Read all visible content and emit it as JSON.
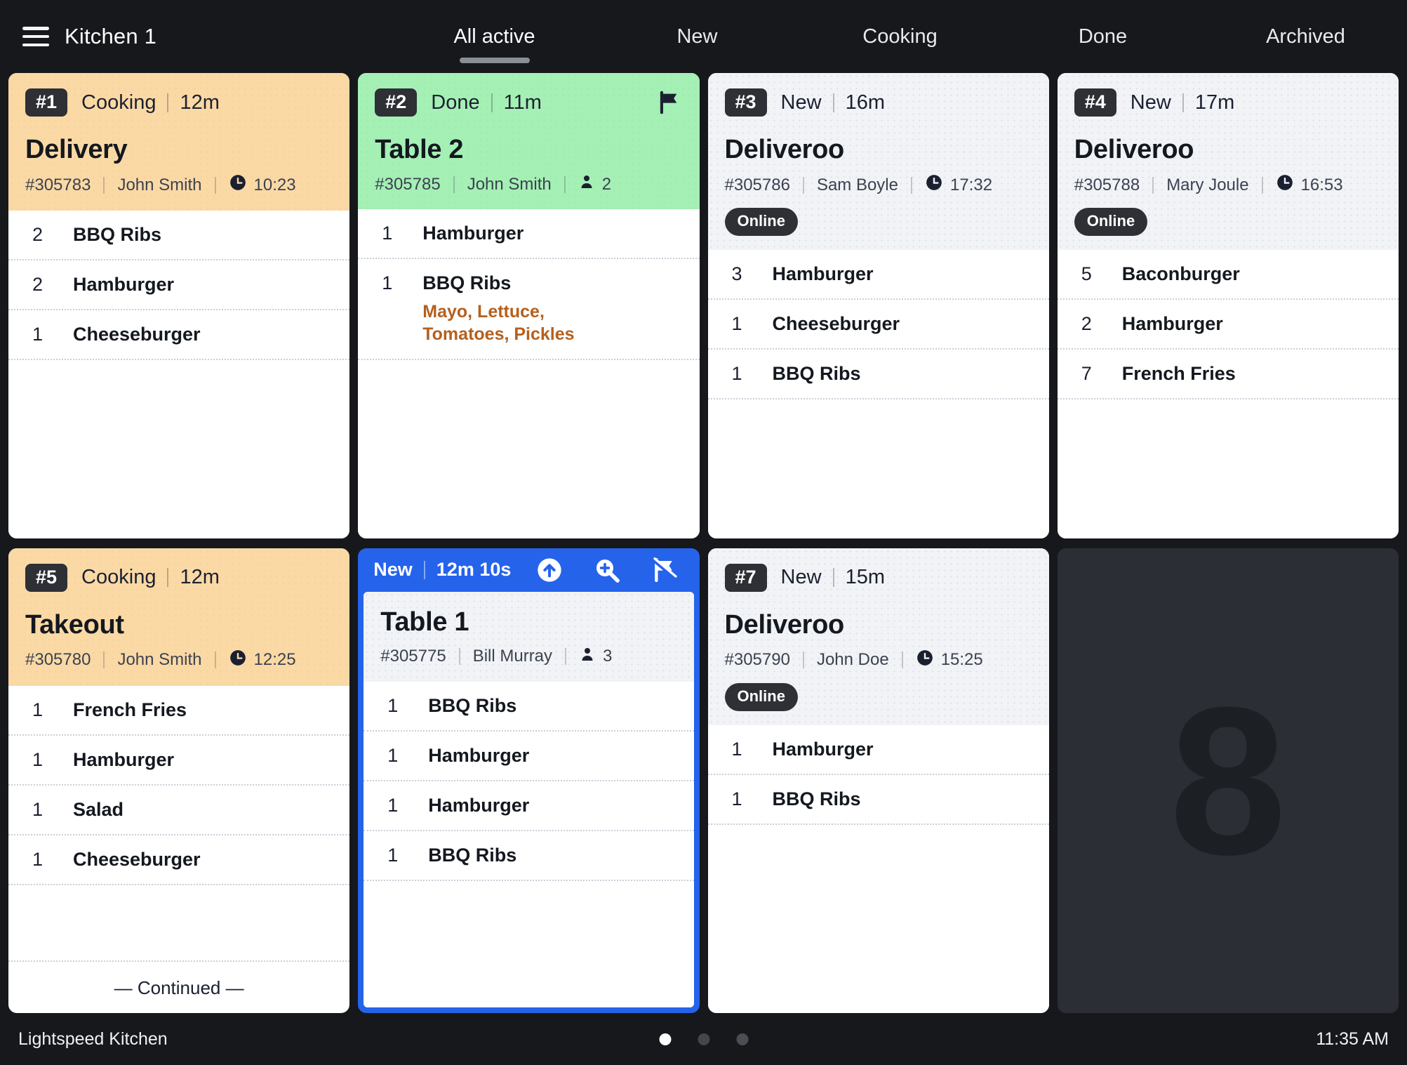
{
  "header": {
    "menu_icon": "hamburger-icon",
    "title": "Kitchen 1",
    "tabs": [
      {
        "label": "All active",
        "active": true
      },
      {
        "label": "New",
        "active": false
      },
      {
        "label": "Cooking",
        "active": false
      },
      {
        "label": "Done",
        "active": false
      },
      {
        "label": "Archived",
        "active": false
      }
    ]
  },
  "colors": {
    "app_background": "#16181c",
    "cooking": "#fbd9a5",
    "done": "#a5f0b5",
    "neutral": "#f1f3f6",
    "selected": "#2563eb",
    "modifier_text": "#b5601d",
    "badge": "#2e3035"
  },
  "cards": [
    {
      "position": "#1",
      "status": "Cooking",
      "elapsed": "12m",
      "title": "Delivery",
      "order_id": "#305783",
      "server": "John Smith",
      "meta_icon": "clock-icon",
      "meta_value": "10:23",
      "badge": null,
      "flagged": false,
      "theme": "cooking",
      "items": [
        {
          "qty": "2",
          "name": "BBQ Ribs",
          "mods": null
        },
        {
          "qty": "2",
          "name": "Hamburger",
          "mods": null
        },
        {
          "qty": "1",
          "name": "Cheeseburger",
          "mods": null
        }
      ],
      "continued": false
    },
    {
      "position": "#2",
      "status": "Done",
      "elapsed": "11m",
      "title": "Table 2",
      "order_id": "#305785",
      "server": "John Smith",
      "meta_icon": "guest-icon",
      "meta_value": "2",
      "badge": null,
      "flagged": true,
      "theme": "done",
      "items": [
        {
          "qty": "1",
          "name": "Hamburger",
          "mods": null
        },
        {
          "qty": "1",
          "name": "BBQ Ribs",
          "mods": "Mayo, Lettuce, Tomatoes, Pickles"
        }
      ],
      "continued": false
    },
    {
      "position": "#3",
      "status": "New",
      "elapsed": "16m",
      "title": "Deliveroo",
      "order_id": "#305786",
      "server": "Sam Boyle",
      "meta_icon": "clock-icon",
      "meta_value": "17:32",
      "badge": "Online",
      "flagged": false,
      "theme": "neutral",
      "items": [
        {
          "qty": "3",
          "name": "Hamburger",
          "mods": null
        },
        {
          "qty": "1",
          "name": "Cheeseburger",
          "mods": null
        },
        {
          "qty": "1",
          "name": "BBQ Ribs",
          "mods": null
        }
      ],
      "continued": false
    },
    {
      "position": "#4",
      "status": "New",
      "elapsed": "17m",
      "title": "Deliveroo",
      "order_id": "#305788",
      "server": "Mary Joule",
      "meta_icon": "clock-icon",
      "meta_value": "16:53",
      "badge": "Online",
      "flagged": false,
      "theme": "neutral",
      "items": [
        {
          "qty": "5",
          "name": "Baconburger",
          "mods": null
        },
        {
          "qty": "2",
          "name": "Hamburger",
          "mods": null
        },
        {
          "qty": "7",
          "name": "French Fries",
          "mods": null
        }
      ],
      "continued": false
    },
    {
      "position": "#5",
      "status": "Cooking",
      "elapsed": "12m",
      "title": "Takeout",
      "order_id": "#305780",
      "server": "John Smith",
      "meta_icon": "clock-icon",
      "meta_value": "12:25",
      "badge": null,
      "flagged": false,
      "theme": "cooking",
      "items": [
        {
          "qty": "1",
          "name": "French Fries",
          "mods": null
        },
        {
          "qty": "1",
          "name": "Hamburger",
          "mods": null
        },
        {
          "qty": "1",
          "name": "Salad",
          "mods": null
        },
        {
          "qty": "1",
          "name": "Cheeseburger",
          "mods": null
        }
      ],
      "continued": true,
      "continued_label": "— Continued —"
    },
    {
      "position": null,
      "status": "New",
      "elapsed": "12m 10s",
      "title": "Table 1",
      "order_id": "#305775",
      "server": "Bill Murray",
      "meta_icon": "guest-icon",
      "meta_value": "3",
      "badge": null,
      "flagged": false,
      "theme": "neutral",
      "selected": true,
      "actions": [
        "bump-up-icon",
        "zoom-in-icon",
        "unflag-icon"
      ],
      "items": [
        {
          "qty": "1",
          "name": "BBQ Ribs",
          "mods": null
        },
        {
          "qty": "1",
          "name": "Hamburger",
          "mods": null
        },
        {
          "qty": "1",
          "name": "Hamburger",
          "mods": null
        },
        {
          "qty": "1",
          "name": "BBQ Ribs",
          "mods": null
        }
      ],
      "continued": false
    },
    {
      "position": "#7",
      "status": "New",
      "elapsed": "15m",
      "title": "Deliveroo",
      "order_id": "#305790",
      "server": "John Doe",
      "meta_icon": "clock-icon",
      "meta_value": "15:25",
      "badge": "Online",
      "flagged": false,
      "theme": "neutral",
      "items": [
        {
          "qty": "1",
          "name": "Hamburger",
          "mods": null
        },
        {
          "qty": "1",
          "name": "BBQ Ribs",
          "mods": null
        }
      ],
      "continued": false
    }
  ],
  "empty_slot": {
    "ghost_number": "8"
  },
  "footer": {
    "app_name": "Lightspeed Kitchen",
    "pages": [
      {
        "active": true
      },
      {
        "active": false
      },
      {
        "active": false
      }
    ],
    "clock": "11:35 AM"
  }
}
